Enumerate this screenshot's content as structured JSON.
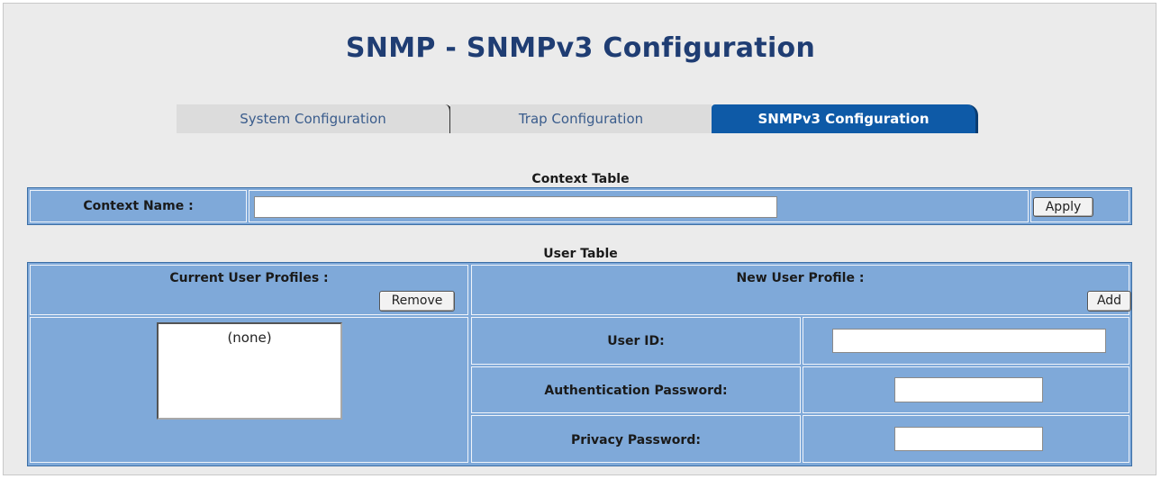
{
  "page": {
    "title": "SNMP - SNMPv3 Configuration"
  },
  "tabs": [
    {
      "label": "System Configuration",
      "active": false
    },
    {
      "label": "Trap Configuration",
      "active": false
    },
    {
      "label": "SNMPv3 Configuration",
      "active": true
    }
  ],
  "context_table": {
    "heading": "Context Table",
    "context_name_label": "Context Name :",
    "context_name_value": "",
    "apply_label": "Apply"
  },
  "user_table": {
    "heading": "User Table",
    "current_profiles_label": "Current User Profiles :",
    "remove_label": "Remove",
    "profiles_list": [
      "(none)"
    ],
    "new_profile_label": "New User Profile :",
    "add_label": "Add",
    "user_id_label": "User ID:",
    "user_id_value": "",
    "auth_password_label": "Authentication Password:",
    "auth_password_value": "",
    "privacy_password_label": "Privacy Password:",
    "privacy_password_value": ""
  },
  "colors": {
    "panel": "#7fa9d9",
    "active_tab": "#0e5aa7",
    "title": "#1f3d73"
  }
}
